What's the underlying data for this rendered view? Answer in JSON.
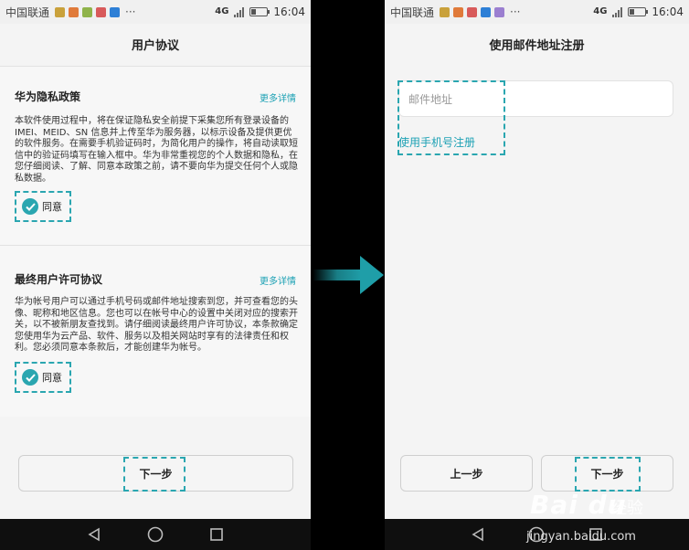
{
  "status": {
    "carrier": "中国联通",
    "more": "···",
    "network": "4G",
    "network_small": "4G",
    "time": "16:04"
  },
  "left": {
    "title": "用户协议",
    "privacy": {
      "title": "华为隐私政策",
      "more": "更多详情",
      "body": "本软件使用过程中，将在保证隐私安全前提下采集您所有登录设备的 IMEI、MEID、SN 信息并上传至华为服务器，以标示设备及提供更优的软件服务。在需要手机验证码时，为简化用户的操作，将自动读取短信中的验证码填写在输入框中。华为非常重视您的个人数据和隐私，在您仔细阅读、了解、同意本政策之前，请不要向华为提交任何个人或隐私数据。",
      "agree": "同意"
    },
    "eula": {
      "title": "最终用户许可协议",
      "more": "更多详情",
      "body": "华为帐号用户可以通过手机号码或邮件地址搜索到您，并可查看您的头像、昵称和地区信息。您也可以在帐号中心的设置中关闭对应的搜索开关，以不被新朋友查找到。请仔细阅读最终用户许可协议，本条款确定您使用华为云产品、软件、服务以及相关网站时享有的法律责任和权利。您必须同意本条款后，才能创建华为帐号。",
      "agree": "同意"
    },
    "next": "下一步"
  },
  "right": {
    "title": "使用邮件地址注册",
    "email_placeholder": "邮件地址",
    "use_phone": "使用手机号注册",
    "prev": "上一步",
    "next": "下一步"
  },
  "colors": {
    "accent": "#2aa6b0",
    "link": "#1ca1b4",
    "arrow": "#1f9ea8"
  },
  "icons": {
    "back": "triangle-left",
    "home": "circle",
    "recents": "square",
    "check": "checkmark"
  },
  "watermark": {
    "logo": "Bai du",
    "cn": "经验",
    "url": "jingyan.baidu.com"
  }
}
